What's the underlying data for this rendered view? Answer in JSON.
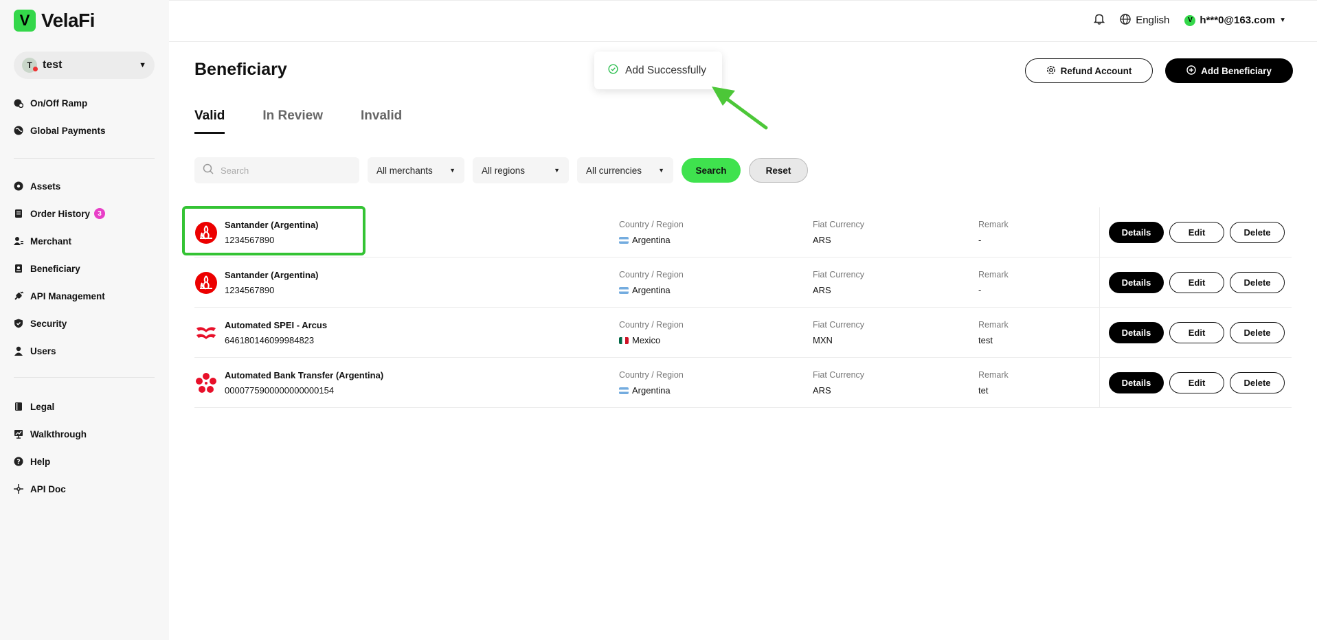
{
  "app": {
    "logo_letter": "V",
    "logo_text": "VelaFi"
  },
  "workspace": {
    "avatar": "T",
    "name": "test"
  },
  "sidebar": {
    "group1": [
      {
        "label": "On/Off Ramp"
      },
      {
        "label": "Global Payments"
      }
    ],
    "group2": [
      {
        "label": "Assets"
      },
      {
        "label": "Order History",
        "badge": "3"
      },
      {
        "label": "Merchant"
      },
      {
        "label": "Beneficiary"
      },
      {
        "label": "API Management"
      },
      {
        "label": "Security"
      },
      {
        "label": "Users"
      }
    ],
    "group3": [
      {
        "label": "Legal"
      },
      {
        "label": "Walkthrough"
      },
      {
        "label": "Help"
      },
      {
        "label": "API Doc"
      }
    ]
  },
  "topbar": {
    "language": "English",
    "user_avatar": "V",
    "user_email": "h***0@163.com"
  },
  "page": {
    "title": "Beneficiary",
    "refund_button": "Refund Account",
    "add_button": "Add Beneficiary"
  },
  "toast": {
    "message": "Add Successfully"
  },
  "tabs": [
    {
      "label": "Valid"
    },
    {
      "label": "In Review"
    },
    {
      "label": "Invalid"
    }
  ],
  "filters": {
    "search_placeholder": "Search",
    "merchants": "All merchants",
    "regions": "All regions",
    "currencies": "All currencies",
    "search_button": "Search",
    "reset_button": "Reset"
  },
  "columns": {
    "country": "Country / Region",
    "currency": "Fiat Currency",
    "remark": "Remark"
  },
  "actions": {
    "details": "Details",
    "edit": "Edit",
    "delete": "Delete"
  },
  "rows": [
    {
      "name": "Santander (Argentina)",
      "account": "1234567890",
      "country": "Argentina",
      "currency": "ARS",
      "remark": "-"
    },
    {
      "name": "Santander (Argentina)",
      "account": "1234567890",
      "country": "Argentina",
      "currency": "ARS",
      "remark": "-"
    },
    {
      "name": "Automated SPEI - Arcus",
      "account": "646180146099984823",
      "country": "Mexico",
      "currency": "MXN",
      "remark": "test"
    },
    {
      "name": "Automated Bank Transfer (Argentina)",
      "account": "0000775900000000000154",
      "country": "Argentina",
      "currency": "ARS",
      "remark": "tet"
    }
  ],
  "colors": {
    "accent": "#3fe24e",
    "brand": "#34d74a",
    "badge": "#e83fc7",
    "bank_red": "#ec0000"
  }
}
